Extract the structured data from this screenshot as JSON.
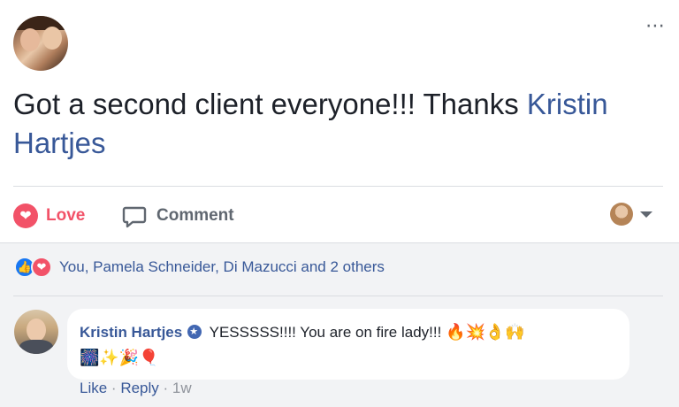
{
  "post": {
    "text_prefix": "Got a second client everyone!!! Thanks ",
    "mention": "Kristin Hartjes",
    "more_icon": "⋯"
  },
  "actions": {
    "love_label": "Love",
    "comment_label": "Comment"
  },
  "reactions": {
    "summary": "You, Pamela Schneider, Di Mazucci and 2 others"
  },
  "comment": {
    "author": "Kristin Hartjes",
    "text": "YESSSSS!!!! You are on fire lady!!!",
    "emojis_line1": "🔥💥👌🙌",
    "emojis_line2": "🎆✨🎉🎈",
    "like_label": "Like",
    "reply_label": "Reply",
    "time": "1w"
  },
  "colors": {
    "link": "#385898",
    "love": "#f25268",
    "like": "#1877f2"
  }
}
